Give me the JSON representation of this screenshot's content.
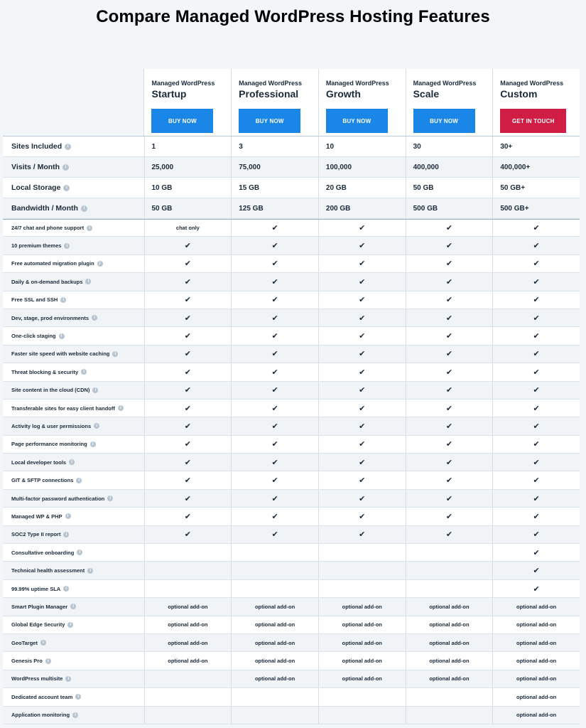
{
  "title": "Compare Managed WordPress Hosting Features",
  "plans": [
    {
      "kicker": "Managed WordPress",
      "name": "Startup",
      "button": "BUY NOW"
    },
    {
      "kicker": "Managed WordPress",
      "name": "Professional",
      "button": "BUY NOW"
    },
    {
      "kicker": "Managed WordPress",
      "name": "Growth",
      "button": "BUY NOW"
    },
    {
      "kicker": "Managed WordPress",
      "name": "Scale",
      "button": "BUY NOW"
    },
    {
      "kicker": "Managed WordPress",
      "name": "Custom",
      "button": "GET IN TOUCH"
    }
  ],
  "colors": {
    "buy_button": "#1a86e8",
    "touch_button": "#d01d44"
  },
  "info_icon": "info-icon",
  "check_icon": "checkmark-icon",
  "specs": [
    {
      "label": "Sites Included",
      "values": [
        "1",
        "3",
        "10",
        "30",
        "30+"
      ]
    },
    {
      "label": "Visits / Month",
      "values": [
        "25,000",
        "75,000",
        "100,000",
        "400,000",
        "400,000+"
      ]
    },
    {
      "label": "Local Storage",
      "values": [
        "10 GB",
        "15 GB",
        "20 GB",
        "50 GB",
        "50 GB+"
      ]
    },
    {
      "label": "Bandwidth / Month",
      "values": [
        "50 GB",
        "125 GB",
        "200 GB",
        "500 GB",
        "500 GB+"
      ]
    }
  ],
  "features": [
    {
      "label": "24/7 chat and phone support",
      "values": [
        "chat only",
        "check",
        "check",
        "check",
        "check"
      ]
    },
    {
      "label": "10 premium themes",
      "values": [
        "check",
        "check",
        "check",
        "check",
        "check"
      ]
    },
    {
      "label": "Free automated migration plugin",
      "values": [
        "check",
        "check",
        "check",
        "check",
        "check"
      ]
    },
    {
      "label": "Daily & on-demand backups",
      "values": [
        "check",
        "check",
        "check",
        "check",
        "check"
      ]
    },
    {
      "label": "Free SSL and SSH",
      "values": [
        "check",
        "check",
        "check",
        "check",
        "check"
      ]
    },
    {
      "label": "Dev, stage, prod environments",
      "values": [
        "check",
        "check",
        "check",
        "check",
        "check"
      ]
    },
    {
      "label": "One-click staging",
      "values": [
        "check",
        "check",
        "check",
        "check",
        "check"
      ]
    },
    {
      "label": "Faster site speed with website caching",
      "values": [
        "check",
        "check",
        "check",
        "check",
        "check"
      ]
    },
    {
      "label": "Threat blocking & security",
      "values": [
        "check",
        "check",
        "check",
        "check",
        "check"
      ]
    },
    {
      "label": "Site content in the cloud (CDN)",
      "values": [
        "check",
        "check",
        "check",
        "check",
        "check"
      ]
    },
    {
      "label": "Transferable sites for easy client handoff",
      "values": [
        "check",
        "check",
        "check",
        "check",
        "check"
      ]
    },
    {
      "label": "Activity log & user permissions",
      "values": [
        "check",
        "check",
        "check",
        "check",
        "check"
      ]
    },
    {
      "label": "Page performance monitoring",
      "values": [
        "check",
        "check",
        "check",
        "check",
        "check"
      ]
    },
    {
      "label": "Local developer tools",
      "values": [
        "check",
        "check",
        "check",
        "check",
        "check"
      ]
    },
    {
      "label": "GIT & SFTP connections",
      "values": [
        "check",
        "check",
        "check",
        "check",
        "check"
      ]
    },
    {
      "label": "Multi-factor password authentication",
      "values": [
        "check",
        "check",
        "check",
        "check",
        "check"
      ]
    },
    {
      "label": "Managed WP & PHP",
      "values": [
        "check",
        "check",
        "check",
        "check",
        "check"
      ]
    },
    {
      "label": "SOC2 Type II report",
      "values": [
        "check",
        "check",
        "check",
        "check",
        "check"
      ]
    },
    {
      "label": "Consultative onboarding",
      "values": [
        "",
        "",
        "",
        "",
        "check"
      ]
    },
    {
      "label": "Technical health assessment",
      "values": [
        "",
        "",
        "",
        "",
        "check"
      ]
    },
    {
      "label": "99.99% uptime SLA",
      "values": [
        "",
        "",
        "",
        "",
        "check"
      ]
    },
    {
      "label": "Smart Plugin Manager",
      "values": [
        "optional add-on",
        "optional add-on",
        "optional add-on",
        "optional add-on",
        "optional add-on"
      ]
    },
    {
      "label": "Global Edge Security",
      "values": [
        "optional add-on",
        "optional add-on",
        "optional add-on",
        "optional add-on",
        "optional add-on"
      ]
    },
    {
      "label": "GeoTarget",
      "values": [
        "optional add-on",
        "optional add-on",
        "optional add-on",
        "optional add-on",
        "optional add-on"
      ]
    },
    {
      "label": "Genesis Pro",
      "values": [
        "optional add-on",
        "optional add-on",
        "optional add-on",
        "optional add-on",
        "optional add-on"
      ]
    },
    {
      "label": "WordPress multisite",
      "values": [
        "",
        "optional add-on",
        "optional add-on",
        "optional add-on",
        "optional add-on"
      ]
    },
    {
      "label": "Dedicated account team",
      "values": [
        "",
        "",
        "",
        "",
        "optional add-on"
      ]
    },
    {
      "label": "Application monitoring",
      "values": [
        "",
        "",
        "",
        "",
        "optional add-on"
      ]
    }
  ]
}
